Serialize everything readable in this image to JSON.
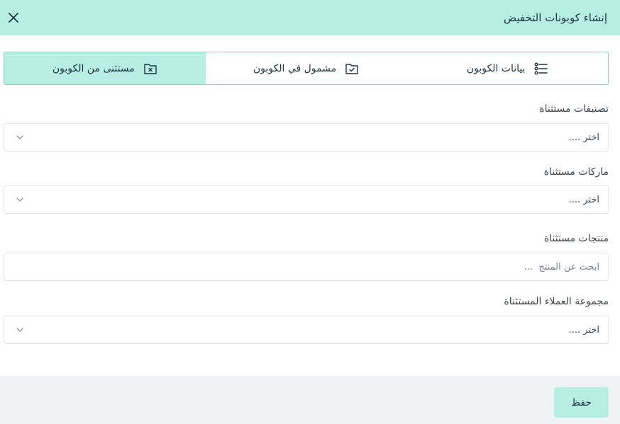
{
  "header": {
    "title": "إنشاء كوبونات التخفيض",
    "close_icon": "close-icon"
  },
  "tabs": [
    {
      "label": "بيانات الكوبون",
      "icon": "list-icon",
      "active": false
    },
    {
      "label": "مشمول في الكوبون",
      "icon": "folder-check-icon",
      "active": false
    },
    {
      "label": "مستثنى من الكوبون",
      "icon": "folder-x-icon",
      "active": true
    }
  ],
  "fields": {
    "excluded_categories": {
      "label": "تصنيفات مستثناة",
      "value": "اختر ...."
    },
    "excluded_brands": {
      "label": "ماركات مستثناة",
      "value": "اختر ...."
    },
    "excluded_products": {
      "label": "منتجات مستثناة",
      "placeholder": "ابحث عن المنتج  ..."
    },
    "excluded_customer_group": {
      "label": "مجموعة العملاء المستثناة",
      "value": "اختر ...."
    }
  },
  "footer": {
    "save_label": "حفظ"
  },
  "colors": {
    "accent": "#b7eee2",
    "accent_border": "#7fd9c5",
    "footer_bg": "#f0f3f6"
  }
}
